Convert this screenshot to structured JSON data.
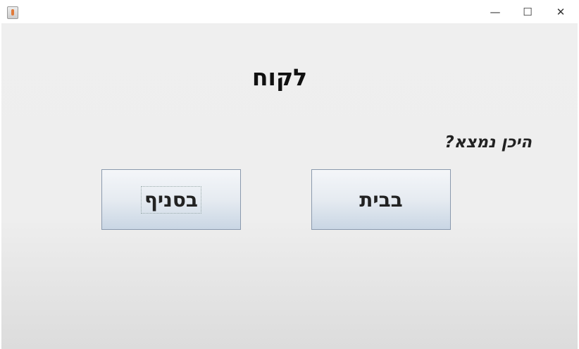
{
  "window": {
    "title": "",
    "controls": {
      "minimize": "—",
      "maximize": "☐",
      "close": "✕"
    }
  },
  "main": {
    "title": "לקוח",
    "question": "היכן נמצא?",
    "buttons": [
      {
        "label": "בסניף",
        "focused": true
      },
      {
        "label": "בבית",
        "focused": false
      }
    ]
  }
}
